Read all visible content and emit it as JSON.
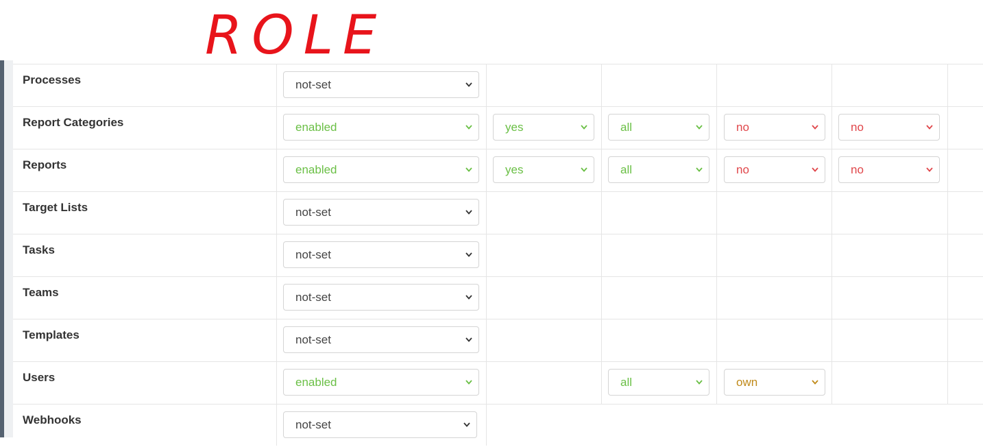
{
  "annotation": {
    "text": "ROLE"
  },
  "rows": [
    {
      "scope": "Processes",
      "cells": [
        {
          "value": "not-set",
          "tone": "neutral"
        },
        null,
        null,
        null,
        null
      ]
    },
    {
      "scope": "Report Categories",
      "cells": [
        {
          "value": "enabled",
          "tone": "green"
        },
        {
          "value": "yes",
          "tone": "green"
        },
        {
          "value": "all",
          "tone": "green"
        },
        {
          "value": "no",
          "tone": "red"
        },
        {
          "value": "no",
          "tone": "red"
        }
      ]
    },
    {
      "scope": "Reports",
      "cells": [
        {
          "value": "enabled",
          "tone": "green"
        },
        {
          "value": "yes",
          "tone": "green"
        },
        {
          "value": "all",
          "tone": "green"
        },
        {
          "value": "no",
          "tone": "red"
        },
        {
          "value": "no",
          "tone": "red"
        }
      ]
    },
    {
      "scope": "Target Lists",
      "cells": [
        {
          "value": "not-set",
          "tone": "neutral"
        },
        null,
        null,
        null,
        null
      ]
    },
    {
      "scope": "Tasks",
      "cells": [
        {
          "value": "not-set",
          "tone": "neutral"
        },
        null,
        null,
        null,
        null
      ]
    },
    {
      "scope": "Teams",
      "cells": [
        {
          "value": "not-set",
          "tone": "neutral"
        },
        null,
        null,
        null,
        null
      ]
    },
    {
      "scope": "Templates",
      "cells": [
        {
          "value": "not-set",
          "tone": "neutral"
        },
        null,
        null,
        null,
        null
      ]
    },
    {
      "scope": "Users",
      "cells": [
        {
          "value": "enabled",
          "tone": "green"
        },
        null,
        {
          "value": "all",
          "tone": "green"
        },
        {
          "value": "own",
          "tone": "orange"
        },
        null
      ]
    },
    {
      "scope": "Webhooks",
      "cells": [
        {
          "value": "not-set",
          "tone": "neutral"
        },
        null,
        null,
        null,
        null
      ]
    }
  ],
  "colors": {
    "green": "#6abf45",
    "red": "#e0464a",
    "orange": "#c08a1a",
    "annotation": "#e8141b"
  },
  "icons": {
    "select_arrow": "chevron-down-icon"
  }
}
